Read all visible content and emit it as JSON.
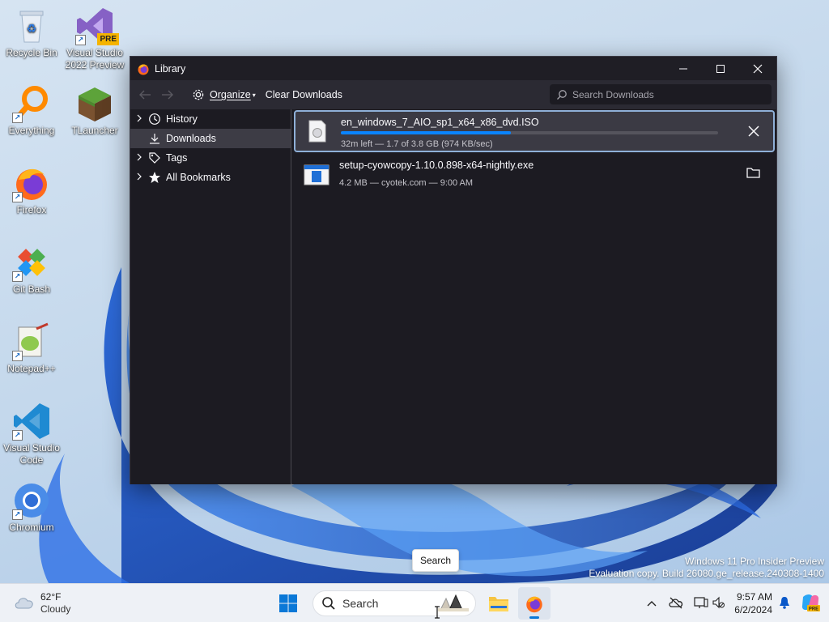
{
  "desktop": {
    "icons": [
      {
        "label": "Recycle Bin"
      },
      {
        "label": "Visual Studio 2022 Preview",
        "badge": "PRE"
      },
      {
        "label": "Everything"
      },
      {
        "label": "TLauncher"
      },
      {
        "label": "Firefox"
      },
      {
        "label": "Git Bash"
      },
      {
        "label": "Notepad++"
      },
      {
        "label": "Visual Studio Code"
      },
      {
        "label": "Chromium"
      }
    ],
    "watermark_line1": "Windows 11 Pro Insider Preview",
    "watermark_line2": "Evaluation copy. Build 26080.ge_release.240308-1400"
  },
  "window": {
    "title": "Library",
    "app_icon": "firefox-icon",
    "controls": [
      "minimize",
      "maximize",
      "close"
    ]
  },
  "toolbar": {
    "organize_label": "Organize",
    "clear_downloads_label": "Clear Downloads",
    "search_placeholder": "Search Downloads"
  },
  "sidebar": {
    "items": [
      {
        "label": "History",
        "icon": "clock-icon",
        "selected": false
      },
      {
        "label": "Downloads",
        "icon": "download-icon",
        "selected": true
      },
      {
        "label": "Tags",
        "icon": "tags-icon",
        "selected": false
      },
      {
        "label": "All Bookmarks",
        "icon": "star-icon",
        "selected": false
      }
    ]
  },
  "downloads": [
    {
      "name": "en_windows_7_AIO_sp1_x64_x86_dvd.ISO",
      "status": "32m left — 1.7 of 3.8 GB (974 KB/sec)",
      "progress": 0.45,
      "action": "cancel",
      "in_progress": true
    },
    {
      "name": "setup-cyowcopy-1.10.0.898-x64-nightly.exe",
      "status": "4.2 MB — cyotek.com — 9:00 AM",
      "action": "open-folder",
      "in_progress": false
    }
  ],
  "tooltip": {
    "text": "Search"
  },
  "taskbar": {
    "weather_temp": "62°F",
    "weather_desc": "Cloudy",
    "search_label": "Search",
    "time": "9:57 AM",
    "date": "6/2/2024"
  },
  "colors": {
    "accent": "#0a84ff",
    "window_bg": "#1c1b22",
    "toolbar_bg": "#2b2a33",
    "selected_row_border": "#8fb0d8"
  }
}
